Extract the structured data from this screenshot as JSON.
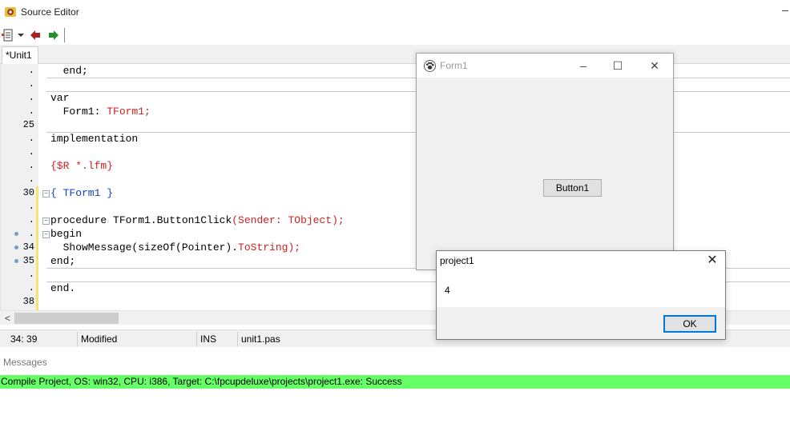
{
  "app": {
    "title": "Source Editor"
  },
  "tabs": [
    {
      "label": "*Unit1"
    }
  ],
  "gutter": [
    {
      "num": ".",
      "bp": false
    },
    {
      "num": ".",
      "bp": false
    },
    {
      "num": ".",
      "bp": false
    },
    {
      "num": ".",
      "bp": false
    },
    {
      "num": "25",
      "bp": false
    },
    {
      "num": ".",
      "bp": false
    },
    {
      "num": ".",
      "bp": false
    },
    {
      "num": ".",
      "bp": false
    },
    {
      "num": ".",
      "bp": false
    },
    {
      "num": "30",
      "bp": false
    },
    {
      "num": ".",
      "bp": false
    },
    {
      "num": ".",
      "bp": false
    },
    {
      "num": ".",
      "bp": true
    },
    {
      "num": "34",
      "bp": true
    },
    {
      "num": "35",
      "bp": true
    },
    {
      "num": ".",
      "bp": false
    },
    {
      "num": ".",
      "bp": false
    },
    {
      "num": "38",
      "bp": false
    }
  ],
  "code": {
    "l1": "  end;",
    "l3": "var",
    "l4a": "  Form1: ",
    "l4b": "TForm1;",
    "l6": "implementation",
    "l8": "{$R *.lfm}",
    "l10": "{ TForm1 }",
    "l12a": "procedure ",
    "l12b": "TForm1.Button1Click",
    "l12c": "(Sender: ",
    "l12d": "TObject);",
    "l13": "begin",
    "l14a": "  ShowMessage(",
    "l14b": "sizeOf(",
    "l14c": "Pointer).",
    "l14d": "ToString);",
    "l15": "end;",
    "l17": "end."
  },
  "status": {
    "position": "34: 39",
    "modified": "Modified",
    "mode": "INS",
    "file": "unit1.pas"
  },
  "messages": {
    "title": "Messages",
    "line": "Compile Project, OS: win32, CPU: i386, Target: C:\\fpcupdeluxe\\projects\\project1.exe: Success"
  },
  "form1": {
    "title": "Form1",
    "button": "Button1"
  },
  "dialog": {
    "title": "project1",
    "message": "4",
    "ok": "OK"
  },
  "icons": {
    "app": "lazarus-icon",
    "form": "paw-icon"
  },
  "colors": {
    "success": "#66ff66",
    "modified_line": "#f5e66b",
    "breakpoint": "#6fa0d0",
    "focus": "#0078d7"
  }
}
